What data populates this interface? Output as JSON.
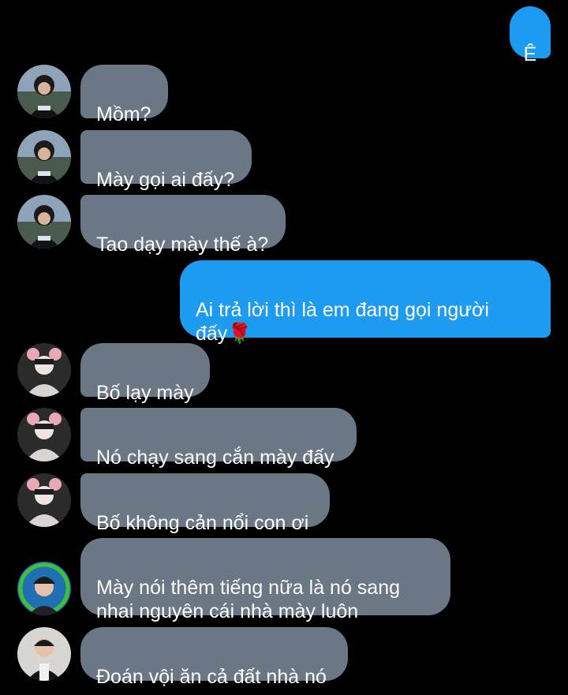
{
  "messages": [
    {
      "side": "out",
      "text": "Ê",
      "avatar": null
    },
    {
      "side": "in",
      "text": "Mồm?",
      "avatar": "avatar-a"
    },
    {
      "side": "in",
      "text": "Mày gọi ai đấy?",
      "avatar": "avatar-a"
    },
    {
      "side": "in",
      "text": "Tao dạy mày thế à?",
      "avatar": "avatar-a"
    },
    {
      "side": "out",
      "text": "Ai trả lời thì là em đang gọi người\nđấy",
      "emoji": "🌹",
      "avatar": null
    },
    {
      "side": "in",
      "text": "Bố lạy mày",
      "avatar": "avatar-b"
    },
    {
      "side": "in",
      "text": "Nó chạy sang cắn mày đấy",
      "avatar": "avatar-b"
    },
    {
      "side": "in",
      "text": "Bố không cản nổi con ơi",
      "avatar": "avatar-b"
    },
    {
      "side": "in",
      "text": "Mày nói thêm tiếng nữa là nó sang\nnhai nguyên cái nhà mày luôn",
      "avatar": "avatar-c"
    },
    {
      "side": "in",
      "text": "Đoán vội ăn cả đất nhà nó",
      "avatar": "avatar-d"
    }
  ],
  "colors": {
    "background": "#000000",
    "incoming_bubble": "#6b7785",
    "outgoing_bubble": "#1d9bf0",
    "text": "#ffffff"
  }
}
